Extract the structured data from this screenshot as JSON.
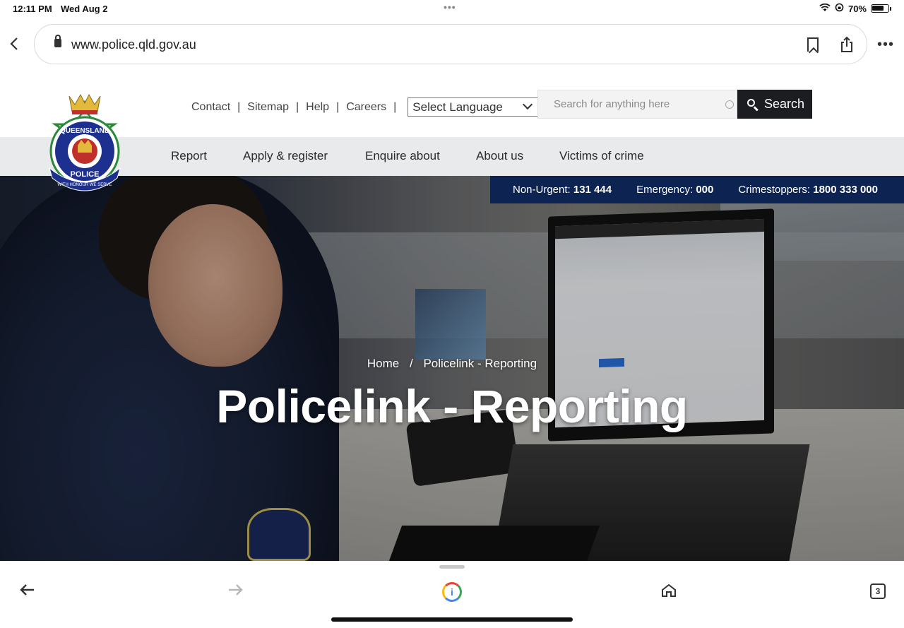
{
  "status_bar": {
    "time": "12:11 PM",
    "date": "Wed Aug 2",
    "battery": "70%"
  },
  "browser": {
    "url": "www.police.qld.gov.au"
  },
  "utility_nav": {
    "links": [
      "Contact",
      "Sitemap",
      "Help",
      "Careers"
    ],
    "language_select": "Select Language"
  },
  "search": {
    "placeholder": "Search for anything here",
    "button_label": "Search"
  },
  "main_nav": {
    "items": [
      "Report",
      "Apply & register",
      "Enquire about",
      "About us",
      "Victims of crime"
    ]
  },
  "contact_strip": {
    "non_urgent_label": "Non-Urgent:",
    "non_urgent_number": "131 444",
    "emergency_label": "Emergency:",
    "emergency_number": "000",
    "crimestoppers_label": "Crimestoppers:",
    "crimestoppers_number": "1800 333 000"
  },
  "breadcrumb": {
    "home": "Home",
    "separator": "/",
    "current": "Policelink - Reporting"
  },
  "page_title": "Policelink - Reporting",
  "toolbar": {
    "tab_count": "3"
  },
  "colors": {
    "nav_bg": "#e9eaeb",
    "contact_strip": "#0d2452",
    "search_button": "#1c1d21"
  }
}
